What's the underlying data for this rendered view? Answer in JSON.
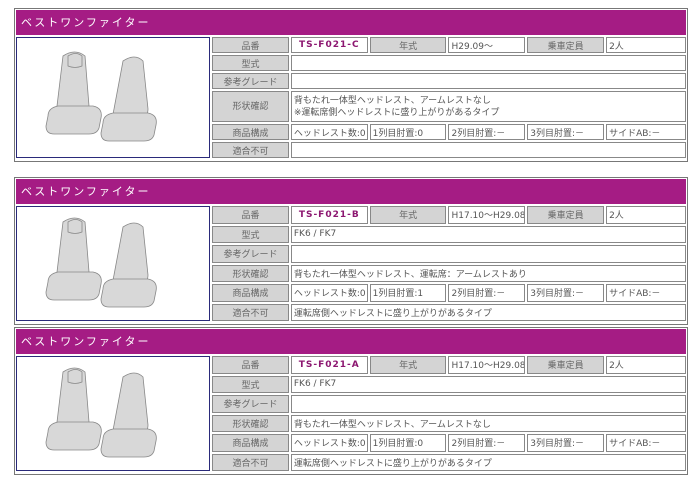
{
  "colors": {
    "header": "#a51c84",
    "code": "#8c1670"
  },
  "labels": {
    "code": "品番",
    "year": "年式",
    "capacity": "乗車定員",
    "model": "型式",
    "grade": "参考グレード",
    "shape": "形状確認",
    "composition": "商品構成",
    "incompatible": "適合不可"
  },
  "products": [
    {
      "title": "ベストワンファイター",
      "code": "TS-F021-C",
      "year": "H29.09～",
      "capacity": "2人",
      "model": "",
      "grade": "",
      "shape": [
        "背もたれ一体型ヘッドレスト、アームレストなし",
        "※運転席側ヘッドレストに盛り上がりがあるタイプ"
      ],
      "composition": [
        "ヘッドレスト数:0",
        "1列目肘置:0",
        "2列目肘置:－",
        "3列目肘置:－",
        "サイドAB:－"
      ],
      "incompatible": "",
      "image": "seat-cover-image"
    },
    {
      "title": "ベストワンファイター",
      "code": "TS-F021-B",
      "year": "H17.10～H29.08",
      "capacity": "2人",
      "model": "FK6 / FK7",
      "grade": "",
      "shape": [
        "背もたれ一体型ヘッドレスト、運転席：アームレストあり"
      ],
      "composition": [
        "ヘッドレスト数:0",
        "1列目肘置:1",
        "2列目肘置:－",
        "3列目肘置:－",
        "サイドAB:－"
      ],
      "incompatible": "運転席側ヘッドレストに盛り上がりがあるタイプ",
      "image": "seat-cover-image"
    },
    {
      "title": "ベストワンファイター",
      "code": "TS-F021-A",
      "year": "H17.10～H29.08",
      "capacity": "2人",
      "model": "FK6 / FK7",
      "grade": "",
      "shape": [
        "背もたれ一体型ヘッドレスト、アームレストなし"
      ],
      "composition": [
        "ヘッドレスト数:0",
        "1列目肘置:0",
        "2列目肘置:－",
        "3列目肘置:－",
        "サイドAB:－"
      ],
      "incompatible": "運転席側ヘッドレストに盛り上がりがあるタイプ",
      "image": "seat-cover-image"
    }
  ]
}
